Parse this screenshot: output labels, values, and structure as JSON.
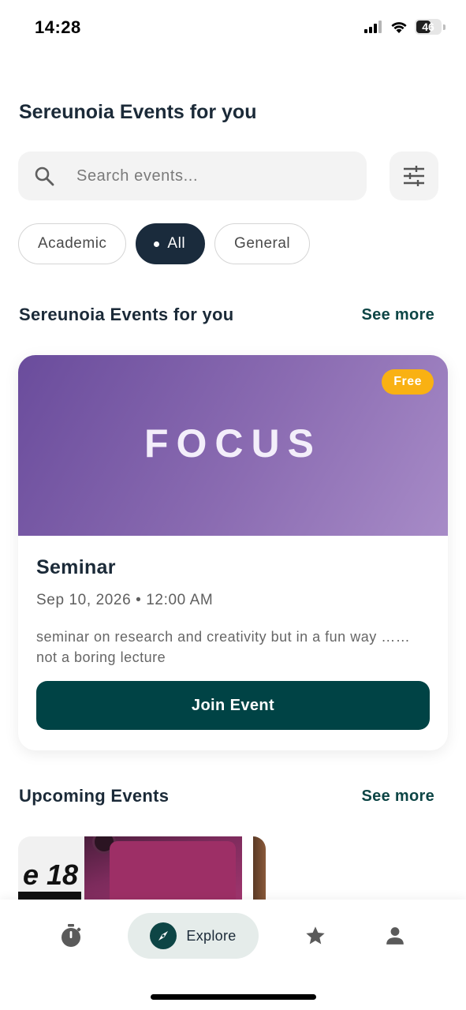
{
  "status_bar": {
    "time": "14:28",
    "battery_level": "46",
    "icons": [
      "cellular-signal-icon",
      "wifi-icon",
      "battery-icon"
    ]
  },
  "page_title": "Sereunoia Events for you",
  "search": {
    "placeholder": "Search events...",
    "value": "",
    "icon": "search-icon"
  },
  "filter": {
    "icon": "sliders-icon"
  },
  "categories": [
    {
      "label": "Academic",
      "selected": false
    },
    {
      "label": "All",
      "selected": true
    },
    {
      "label": "General",
      "selected": false
    }
  ],
  "featured_section": {
    "title": "Sereunoia Events for you",
    "see_more": "See more"
  },
  "featured_event": {
    "banner_text": "FOCUS",
    "badge": "Free",
    "title": "Seminar",
    "datetime": "Sep 10, 2026 • 12:00 AM",
    "description": "seminar on research and creativity but in a fun way …… not a boring lecture",
    "join_label": "Join Event"
  },
  "upcoming_section": {
    "title": "Upcoming Events",
    "see_more": "See more",
    "first_card_image_text": "e 18"
  },
  "bottom_nav": {
    "items": [
      {
        "name": "timer",
        "icon": "stopwatch-icon",
        "label": ""
      },
      {
        "name": "explore",
        "icon": "compass-icon",
        "label": "Explore",
        "active": true
      },
      {
        "name": "favorites",
        "icon": "star-icon",
        "label": ""
      },
      {
        "name": "profile",
        "icon": "person-icon",
        "label": ""
      }
    ]
  },
  "colors": {
    "primary_dark": "#1a2b3c",
    "accent_teal": "#004345",
    "badge_yellow": "#f9b113",
    "banner_purple": "#8b6cb2"
  }
}
